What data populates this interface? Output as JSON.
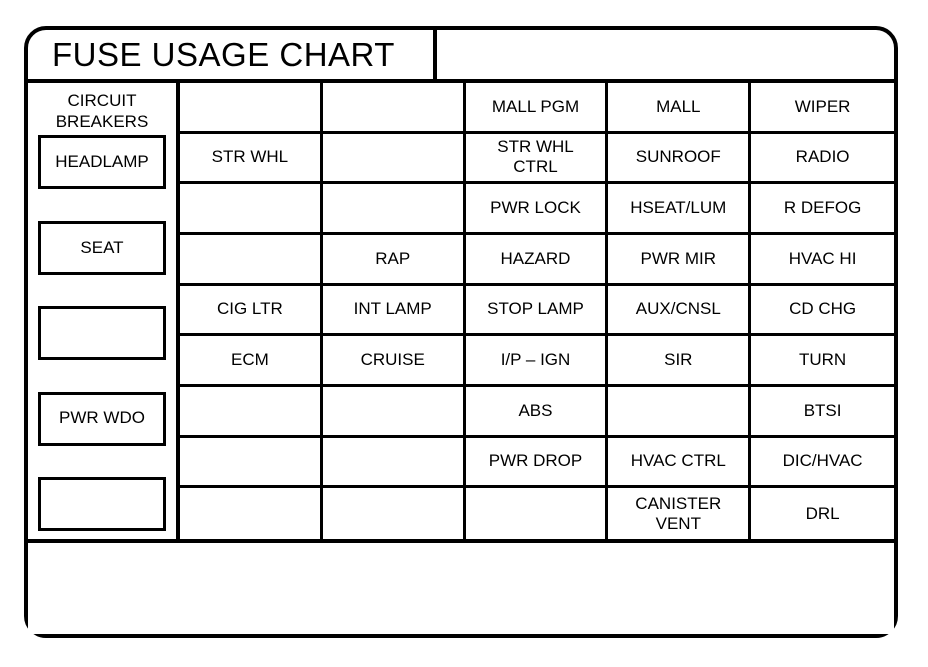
{
  "header": {
    "title": "FUSE USAGE CHART",
    "blank_cell": ""
  },
  "breakers": {
    "heading": "CIRCUIT\nBREAKERS",
    "items": [
      {
        "label": "HEADLAMP"
      },
      {
        "label": "SEAT"
      },
      {
        "label": ""
      },
      {
        "label": "PWR WDO"
      },
      {
        "label": ""
      }
    ]
  },
  "grid": {
    "columns": 5,
    "rows": 9,
    "cells": [
      [
        "",
        "",
        "MALL PGM",
        "MALL",
        "WIPER"
      ],
      [
        "STR WHL",
        "",
        "STR WHL\nCTRL",
        "SUNROOF",
        "RADIO"
      ],
      [
        "",
        "",
        "PWR LOCK",
        "HSEAT/LUM",
        "R DEFOG"
      ],
      [
        "",
        "RAP",
        "HAZARD",
        "PWR MIR",
        "HVAC HI"
      ],
      [
        "CIG LTR",
        "INT LAMP",
        "STOP LAMP",
        "AUX/CNSL",
        "CD CHG"
      ],
      [
        "ECM",
        "CRUISE",
        "I/P – IGN",
        "SIR",
        "TURN"
      ],
      [
        "",
        "",
        "ABS",
        "",
        "BTSI"
      ],
      [
        "",
        "",
        "PWR DROP",
        "HVAC CTRL",
        "DIC/HVAC"
      ],
      [
        "",
        "",
        "",
        "CANISTER\nVENT",
        "DRL"
      ]
    ]
  },
  "footer": {
    "note": ""
  },
  "colors": {
    "border": "#000000",
    "background": "#ffffff",
    "text": "#000000"
  }
}
